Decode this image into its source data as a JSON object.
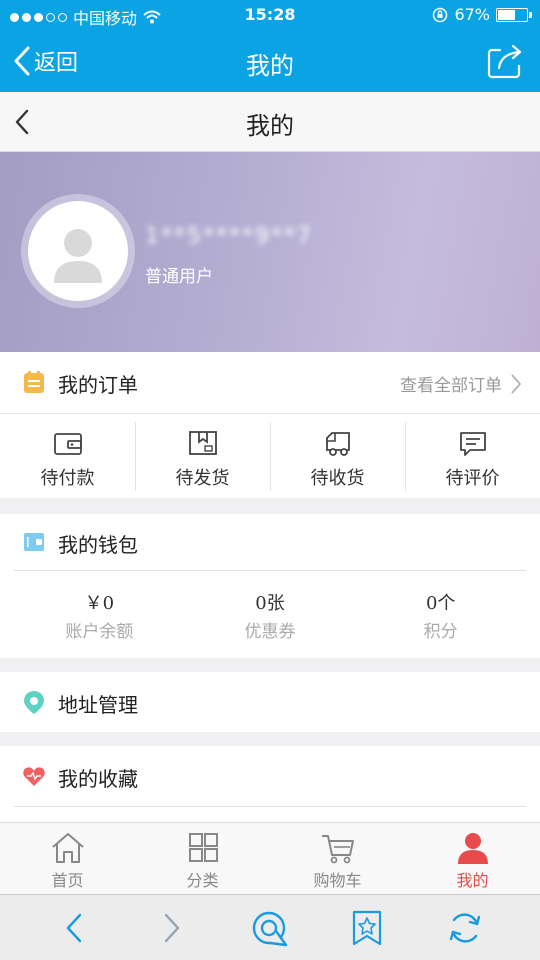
{
  "status_bar": {
    "carrier": "中国移动",
    "time": "15:28",
    "battery_percent": "67%",
    "battery_level": 0.67
  },
  "app_bar": {
    "back_label": "返回",
    "title": "我的",
    "share_icon": "share-icon"
  },
  "sub_header": {
    "title": "我的"
  },
  "profile": {
    "username": "1**5****9**7",
    "user_type": "普通用户"
  },
  "orders": {
    "title": "我的订单",
    "view_all": "查看全部订单",
    "items": [
      {
        "label": "待付款",
        "icon": "wallet-icon"
      },
      {
        "label": "待发货",
        "icon": "package-icon"
      },
      {
        "label": "待收货",
        "icon": "truck-icon"
      },
      {
        "label": "待评价",
        "icon": "comment-icon"
      }
    ]
  },
  "wallet": {
    "title": "我的钱包",
    "items": [
      {
        "value": "￥0",
        "label": "账户余额"
      },
      {
        "value": "0张",
        "label": "优惠券"
      },
      {
        "value": "0个",
        "label": "积分"
      }
    ]
  },
  "address": {
    "title": "地址管理"
  },
  "favorites": {
    "title": "我的收藏"
  },
  "tab_bar": {
    "items": [
      {
        "label": "首页",
        "icon": "home-icon"
      },
      {
        "label": "分类",
        "icon": "grid-icon"
      },
      {
        "label": "购物车",
        "icon": "cart-icon"
      },
      {
        "label": "我的",
        "icon": "user-icon"
      }
    ],
    "active_index": 3
  },
  "colors": {
    "primary": "#0aa4e4",
    "active_tab": "#e84b4b",
    "orders_icon": "#f7b84b",
    "wallet_icon": "#7ecbf0",
    "address_icon": "#5fd3c3",
    "favorites_icon": "#f06060"
  }
}
